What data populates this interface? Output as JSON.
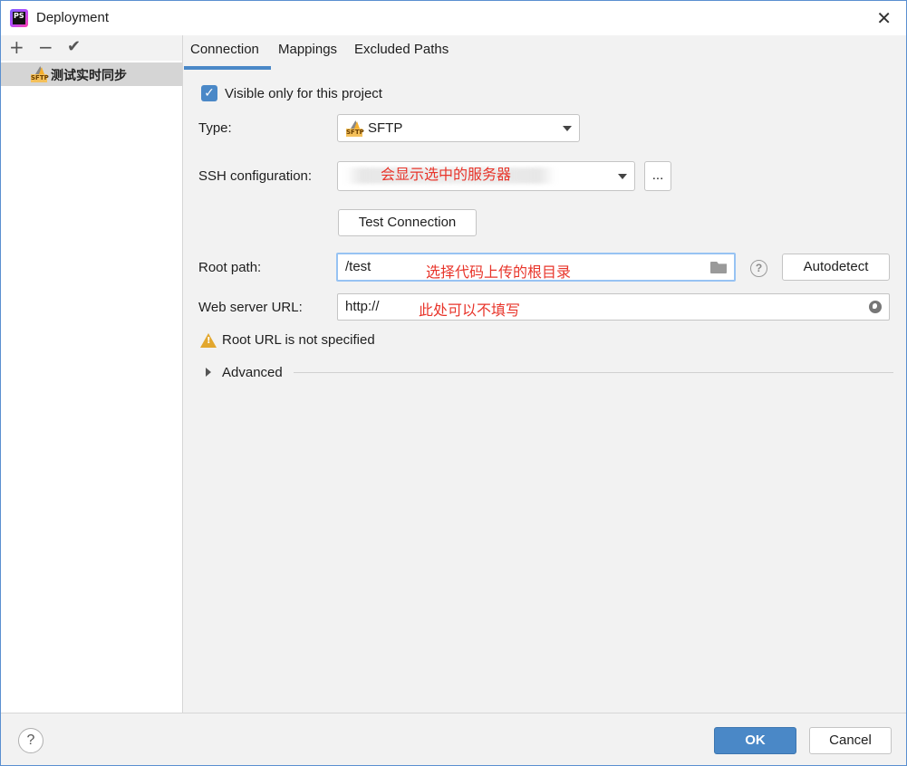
{
  "window": {
    "title": "Deployment",
    "app_icon": "phpstorm-logo",
    "app_icon_text": "PS",
    "close_glyph": "✕"
  },
  "left_toolbar": {
    "add_glyph": "+",
    "remove_glyph": "−",
    "apply_glyph": "✔"
  },
  "server_list": {
    "items": [
      {
        "label": "测试实时同步",
        "icon": "sftp-icon",
        "icon_text": "SFTP",
        "selected": true
      }
    ]
  },
  "tabs": [
    {
      "label": "Connection",
      "active": true
    },
    {
      "label": "Mappings",
      "active": false
    },
    {
      "label": "Excluded Paths",
      "active": false
    }
  ],
  "form": {
    "visible_only_label": "Visible only for this project",
    "visible_only_checked": true,
    "check_glyph": "✓",
    "type_label": "Type:",
    "type_value": "SFTP",
    "type_icon_text": "SFTP",
    "ssh_label": "SSH configuration:",
    "ssh_annotation": "会显示选中的服务器",
    "ssh_more_label": "...",
    "test_connection_label": "Test Connection",
    "root_path_label": "Root path:",
    "root_path_value": "/test",
    "root_path_annotation": "选择代码上传的根目录",
    "help_glyph": "?",
    "autodetect_label": "Autodetect",
    "web_url_label": "Web server URL:",
    "web_url_value": "http://",
    "web_url_annotation": "此处可以不填写",
    "warning_glyph": "!",
    "warning_text": "Root URL is not specified",
    "advanced_label": "Advanced"
  },
  "footer": {
    "help_glyph": "?",
    "ok_label": "OK",
    "cancel_label": "Cancel"
  },
  "colors": {
    "accent": "#4a88c7",
    "annotation": "#e8352b",
    "warning": "#e2a72e"
  }
}
